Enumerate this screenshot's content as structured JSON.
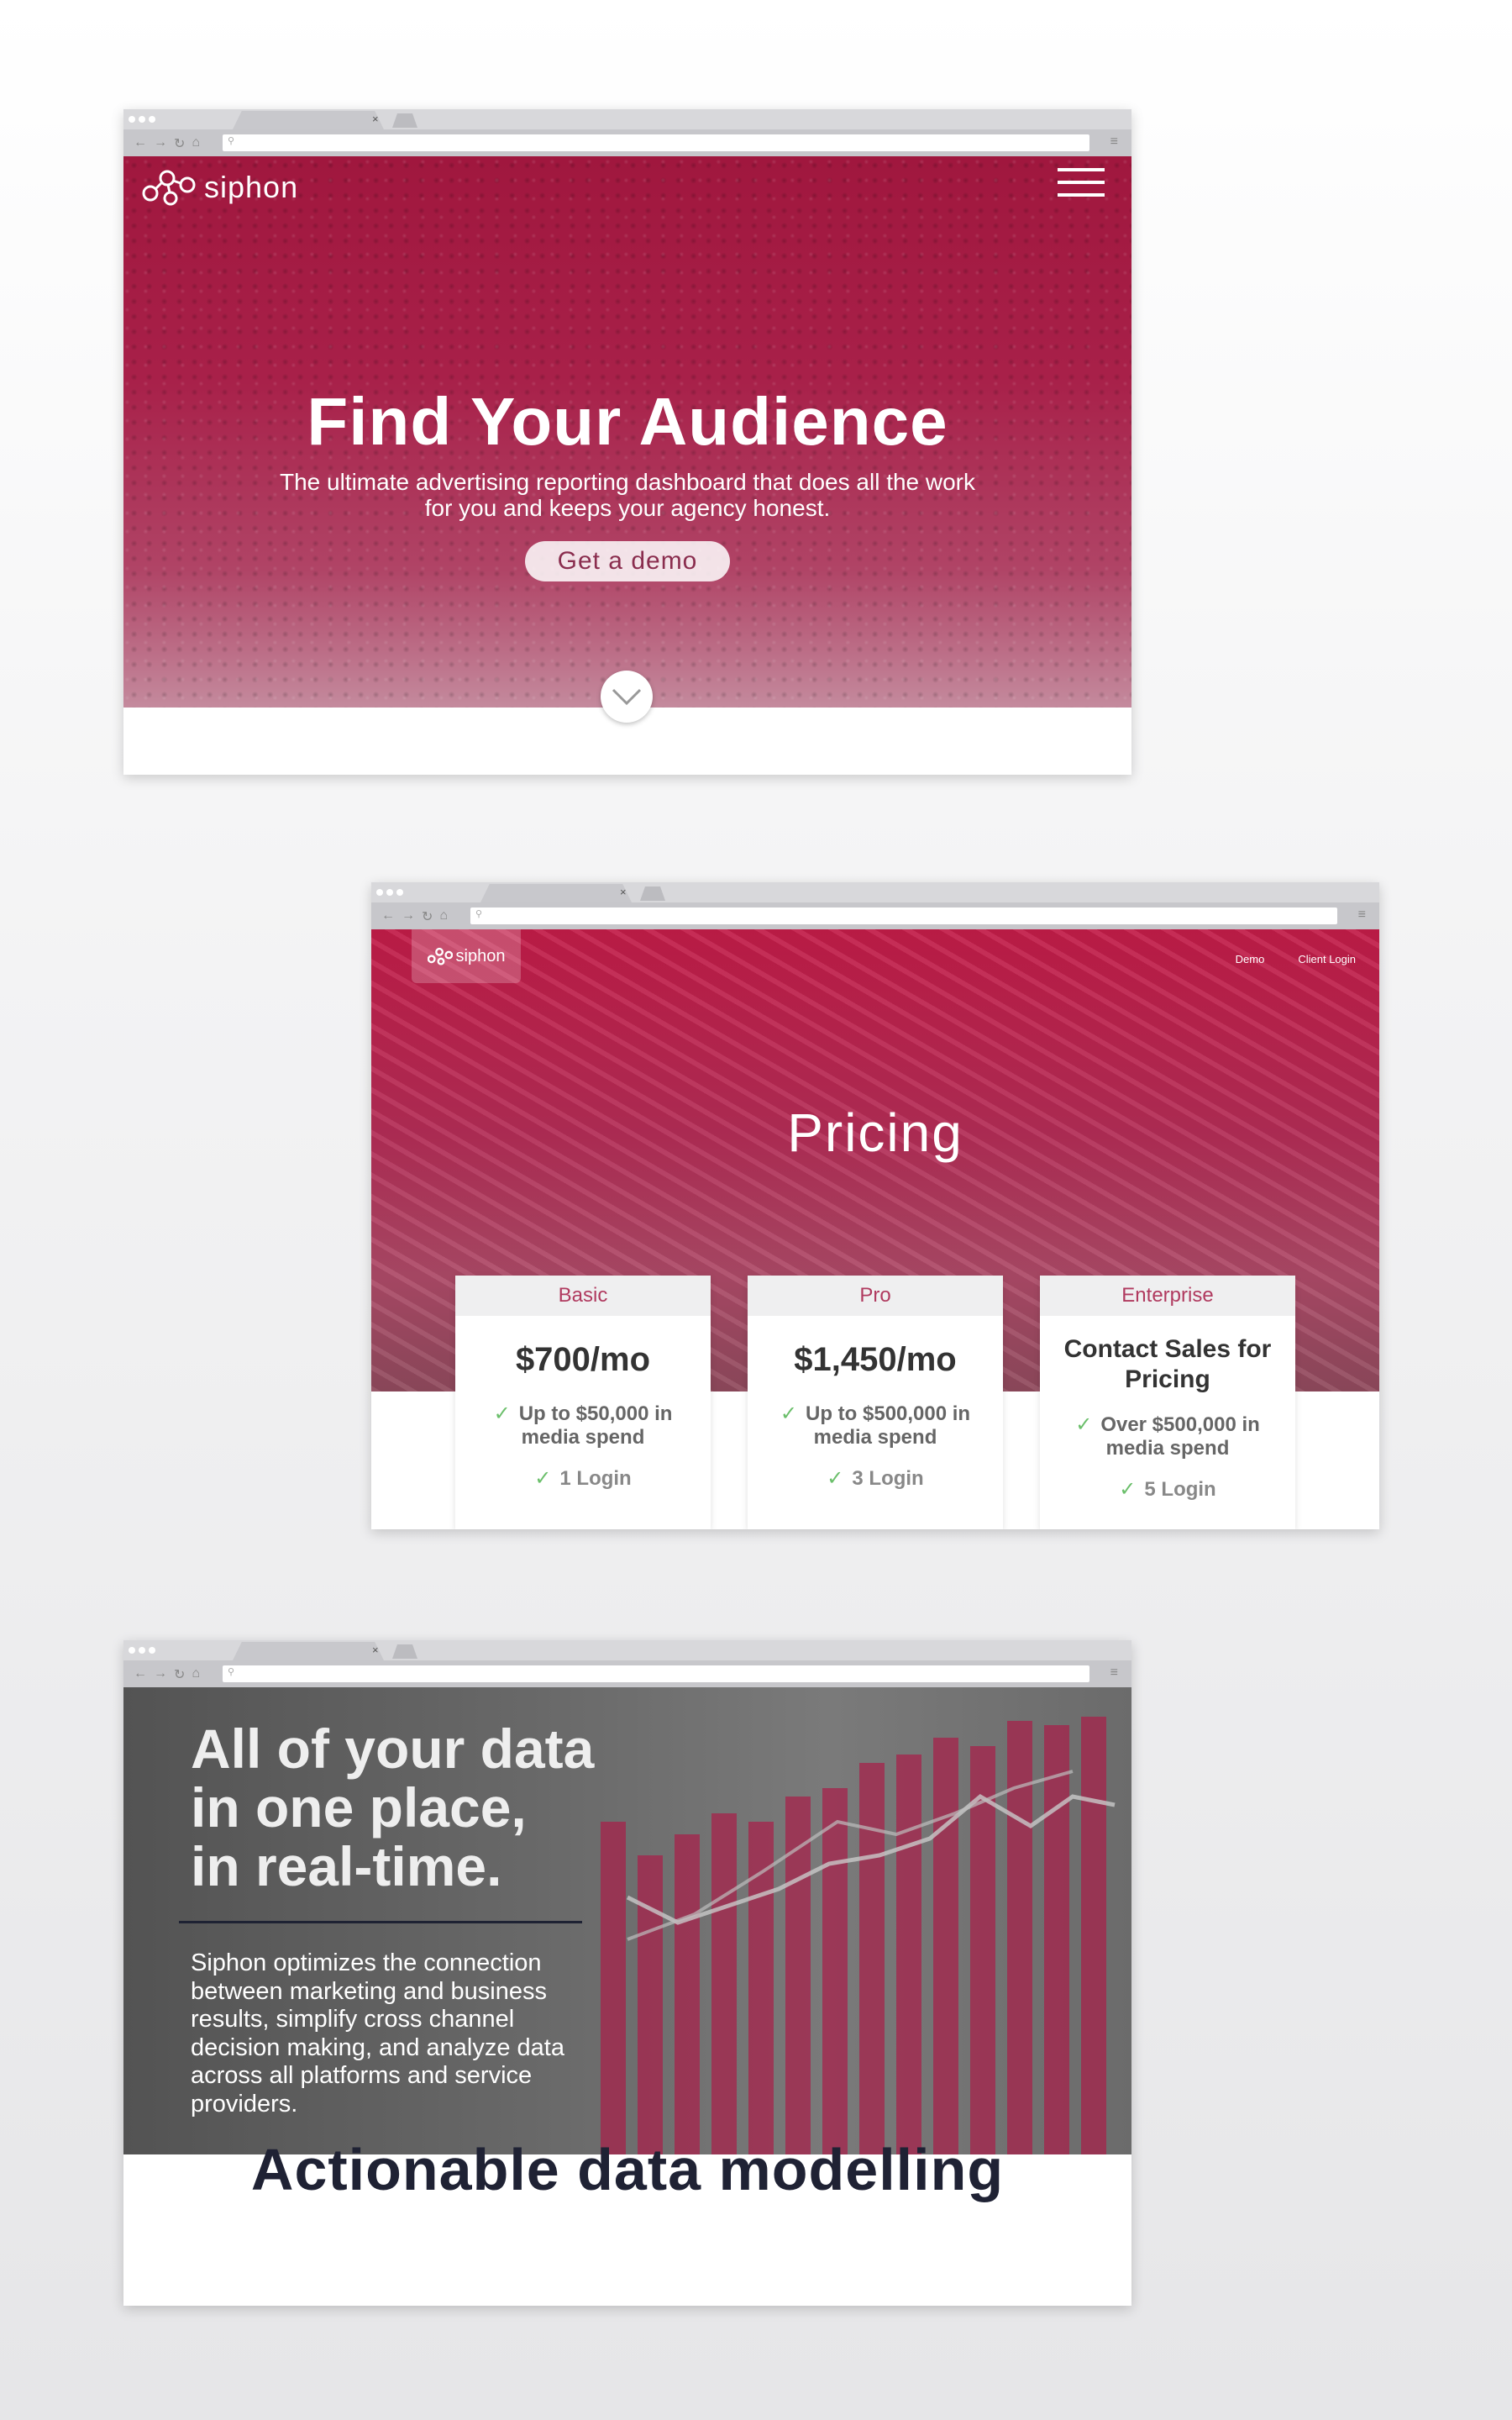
{
  "hero": {
    "logo_text": "siphon",
    "title": "Find Your Audience",
    "subtitle": "The ultimate advertising reporting dashboard that does all the work for you and keeps your agency honest.",
    "cta_label": "Get a demo"
  },
  "pricing": {
    "logo_text": "siphon",
    "nav": [
      "Demo",
      "Client Login"
    ],
    "title": "Pricing",
    "plans": [
      {
        "name": "Basic",
        "price": "$700/mo",
        "feature": "Up to $50,000 in media spend",
        "logins": "1 Login"
      },
      {
        "name": "Pro",
        "price": "$1,450/mo",
        "feature": "Up to $500,000 in media spend",
        "logins": "3 Login"
      },
      {
        "name": "Enterprise",
        "price": "Contact Sales for Pricing",
        "feature": "Over $500,000 in media spend",
        "logins": "5 Login"
      }
    ]
  },
  "data_section": {
    "title_lines": [
      "All of your data",
      "in one place,",
      "in real-time."
    ],
    "body": "Siphon optimizes the connection between marketing and business results, simplify cross channel decision making, and analyze data across all platforms and service providers.",
    "caption": "Actionable data modelling"
  },
  "icons": [
    "back-icon",
    "forward-icon",
    "reload-icon",
    "home-icon",
    "search-icon",
    "menu-icon",
    "chevron-down-icon",
    "check-icon",
    "logo-mark-icon"
  ],
  "colors": {
    "brand": "#a8204a",
    "check": "#6bbf6b",
    "dark_text": "#1f2234"
  }
}
